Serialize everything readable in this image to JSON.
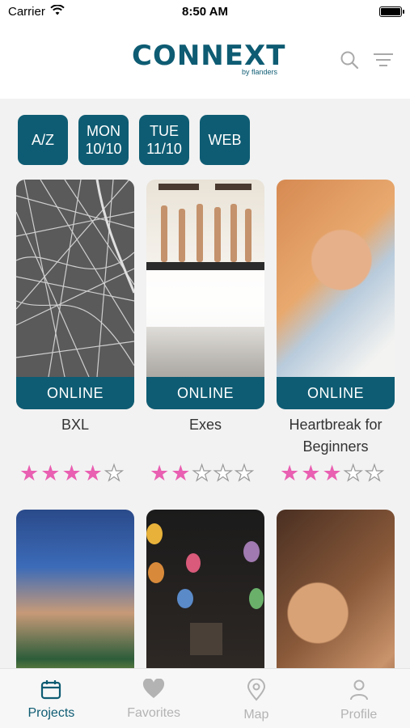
{
  "status_bar": {
    "carrier": "Carrier",
    "time": "8:50 AM"
  },
  "header": {
    "logo_text": "CONNEXT",
    "logo_sub": "by flanders"
  },
  "chips": [
    {
      "label": "A/Z"
    },
    {
      "label": "MON\n10/10"
    },
    {
      "label": "TUE\n11/10"
    },
    {
      "label": "WEB"
    }
  ],
  "cards": [
    {
      "title": "BXL",
      "badge": "ONLINE",
      "rating": 4,
      "max_rating": 5
    },
    {
      "title": "Exes",
      "badge": "ONLINE",
      "rating": 2,
      "max_rating": 5
    },
    {
      "title": "Heartbreak for Beginners",
      "badge": "ONLINE",
      "rating": 3,
      "max_rating": 5
    },
    {
      "title": "",
      "badge": ""
    },
    {
      "title": "",
      "badge": ""
    },
    {
      "title": "",
      "badge": ""
    }
  ],
  "tabs": [
    {
      "label": "Projects",
      "icon": "calendar-icon",
      "active": true
    },
    {
      "label": "Favorites",
      "icon": "heart-icon",
      "active": false
    },
    {
      "label": "Map",
      "icon": "map-pin-icon",
      "active": false
    },
    {
      "label": "Profile",
      "icon": "person-icon",
      "active": false
    }
  ],
  "colors": {
    "accent": "#0e5c73",
    "star": "#e95fb1",
    "inactive": "#b3b3b3"
  }
}
